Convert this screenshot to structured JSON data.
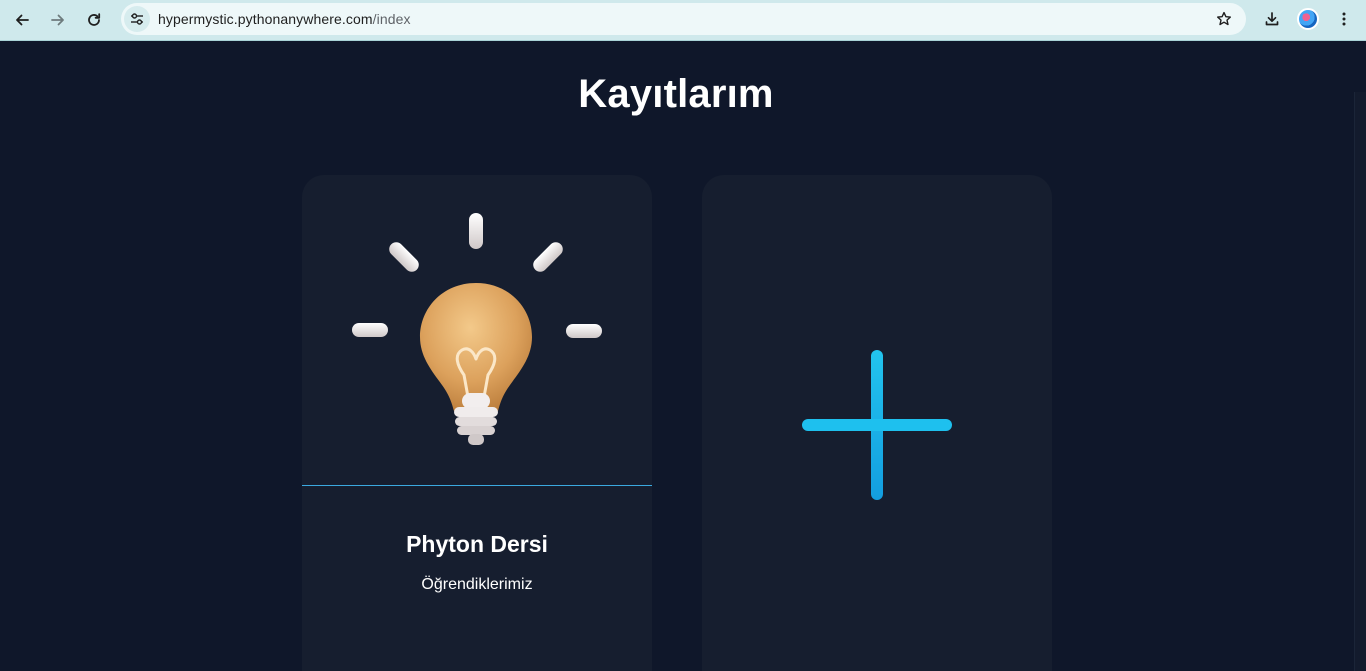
{
  "browser": {
    "url_host": "hypermystic.pythonanywhere.com",
    "url_path": "/index"
  },
  "page": {
    "title": "Kayıtlarım"
  },
  "cards": [
    {
      "title": "Phyton Dersi",
      "description": "Öğrendiklerimiz",
      "image_icon": "lightbulb-icon"
    },
    {
      "icon": "plus-icon",
      "accent_color": "#1ec0ee"
    }
  ],
  "colors": {
    "background": "#0f172a",
    "card": "#161e2f",
    "divider": "#3ba9e0",
    "accent": "#1ec0ee"
  }
}
